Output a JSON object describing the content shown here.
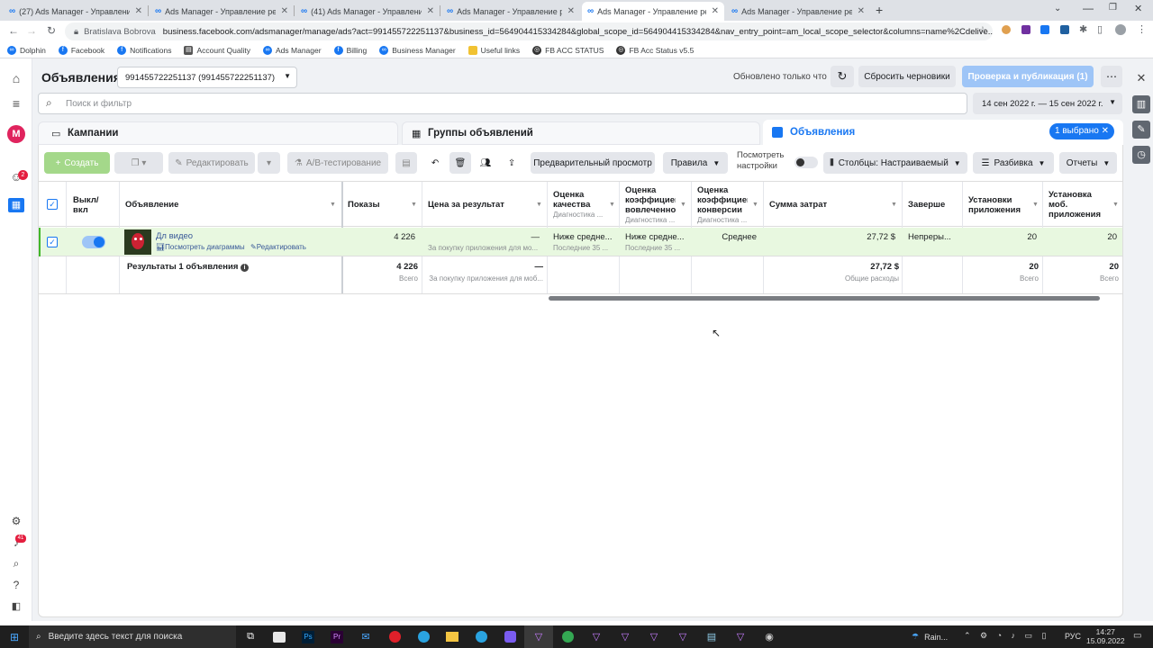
{
  "browser": {
    "tabs": [
      {
        "title": "(27) Ads Manager - Управление"
      },
      {
        "title": "Ads Manager - Управление рек"
      },
      {
        "title": "(41) Ads Manager - Управлени"
      },
      {
        "title": "Ads Manager - Управление рек"
      },
      {
        "title": "Ads Manager - Управление рек"
      },
      {
        "title": "Ads Manager - Управление рек"
      }
    ],
    "url_account": "Bratislava Bobrova",
    "url": "business.facebook.com/adsmanager/manage/ads?act=991455722251137&business_id=564904415334284&global_scope_id=564904415334284&nav_entry_point=am_local_scope_selector&columns=name%2Cdelive...",
    "bookmarks": [
      "Dolphin",
      "Facebook",
      "Notifications",
      "Account Quality",
      "Ads Manager",
      "Billing",
      "Business Manager",
      "Useful links",
      "FB ACC STATUS",
      "FB Acc Status v5.5"
    ]
  },
  "left_nav": {
    "avatar_letter": "M",
    "notif_badge": "2",
    "alerts_badge": "41"
  },
  "header": {
    "title": "Объявления",
    "account_select": "991455722251137 (991455722251137)",
    "updated": "Обновлено только что",
    "discard": "Сбросить черновики",
    "publish": "Проверка и публикация (1)"
  },
  "search": {
    "placeholder": "Поиск и фильтр",
    "date_range": "14 сен 2022 г. — 15 сен 2022 г."
  },
  "level_tabs": {
    "campaigns": "Кампании",
    "adsets": "Группы объявлений",
    "ads": "Объявления",
    "selected": "1 выбрано"
  },
  "toolbar": {
    "create": "Создать",
    "edit": "Редактировать",
    "ab_test": "A/B-тестирование",
    "preview": "Предварительный просмотр",
    "rules": "Правила",
    "view_settings_1": "Посмотреть",
    "view_settings_2": "настройки",
    "columns": "Столбцы: Настраиваемый",
    "breakdown": "Разбивка",
    "reports": "Отчеты"
  },
  "table": {
    "headers": {
      "toggle_1": "Выкл/",
      "toggle_2": "вкл",
      "ad": "Объявление",
      "impressions": "Показы",
      "cost_per_result": "Цена за результат",
      "quality_1": "Оценка",
      "quality_2": "качества",
      "quality_sub": "Диагностика ...",
      "engagement_1": "Оценка",
      "engagement_2": "коэффициент",
      "engagement_3": "вовлеченно",
      "engagement_sub": "Диагностика ...",
      "conversion_1": "Оценка",
      "conversion_2": "коэффициент",
      "conversion_3": "конверсии",
      "conversion_sub": "Диагностика ...",
      "spend": "Сумма затрат",
      "ends": "Заверше",
      "installs_1": "Установки",
      "installs_2": "приложения",
      "mobile_installs_1": "Установка",
      "mobile_installs_2": "моб.",
      "mobile_installs_3": "приложения"
    },
    "row": {
      "name": "Дл видео",
      "view_charts": "Посмотреть диаграммы",
      "edit": "Редактировать",
      "impressions": "4 226",
      "cost_dash": "—",
      "cost_sub": "За покупку приложения для мо...",
      "quality": "Ниже средне...",
      "quality_sub": "Последние 35 ...",
      "engagement": "Ниже средне...",
      "engagement_sub": "Последние 35 ...",
      "conversion": "Среднее",
      "spend": "27,72 $",
      "ends": "Непреры...",
      "installs": "20",
      "mobile_installs": "20"
    },
    "totals": {
      "label": "Результаты 1 объявления",
      "impressions": "4 226",
      "impressions_sub": "Всего",
      "cost_dash": "—",
      "cost_sub": "За покупку приложения для моб...",
      "spend": "27,72 $",
      "spend_sub": "Общие расходы",
      "installs": "20",
      "installs_sub": "Всего",
      "mobile_installs": "20",
      "mobile_installs_sub": "Всего"
    }
  },
  "taskbar": {
    "search_placeholder": "Введите здесь текст для поиска",
    "weather": "Rain...",
    "lang": "РУС",
    "time": "14:27",
    "date": "15.09.2022"
  },
  "colors": {
    "accent": "#1877f2",
    "create_green": "#a4d88a",
    "row_selected": "#e8f8e0",
    "publish_disabled": "#9ec5f7"
  }
}
